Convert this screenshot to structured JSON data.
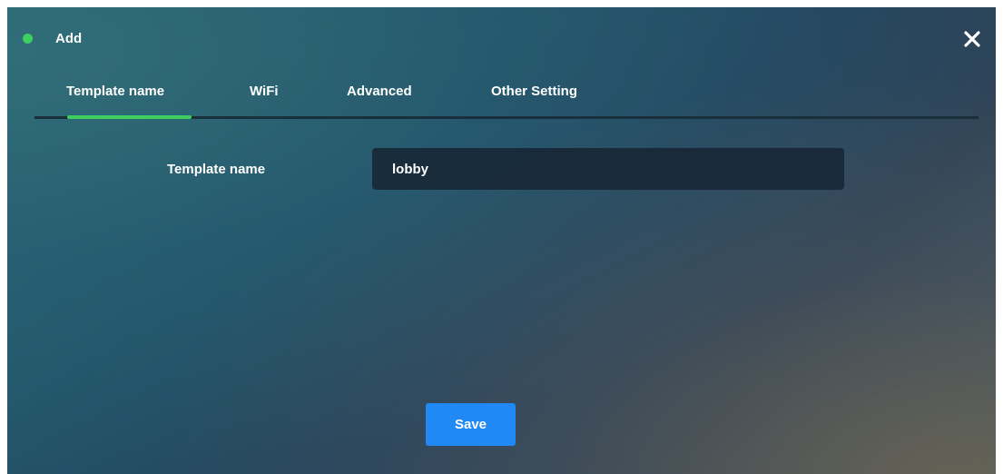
{
  "dialog": {
    "title": "Add",
    "close_icon": "close-icon",
    "status_color": "#3ecf61"
  },
  "tabs": [
    {
      "label": "Template name",
      "active": true
    },
    {
      "label": "WiFi",
      "active": false
    },
    {
      "label": "Advanced",
      "active": false
    },
    {
      "label": "Other Setting",
      "active": false
    }
  ],
  "form": {
    "template_name_label": "Template name",
    "template_name_value": "lobby"
  },
  "actions": {
    "save_label": "Save"
  },
  "colors": {
    "accent_green": "#3ecf61",
    "primary_button": "#2089f5"
  }
}
